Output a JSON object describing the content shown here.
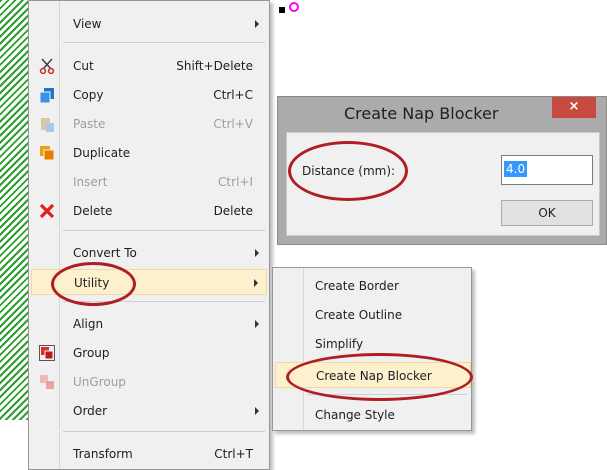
{
  "context_menu": {
    "items": [
      {
        "label": "View",
        "shortcut": "",
        "submenu": true,
        "disabled": false,
        "icon": ""
      },
      {
        "label": "Cut",
        "shortcut": "Shift+Delete",
        "submenu": false,
        "disabled": false,
        "icon": "scissors-icon"
      },
      {
        "label": "Copy",
        "shortcut": "Ctrl+C",
        "submenu": false,
        "disabled": false,
        "icon": "copy-icon"
      },
      {
        "label": "Paste",
        "shortcut": "Ctrl+V",
        "submenu": false,
        "disabled": true,
        "icon": "paste-icon"
      },
      {
        "label": "Duplicate",
        "shortcut": "",
        "submenu": false,
        "disabled": false,
        "icon": "duplicate-icon"
      },
      {
        "label": "Insert",
        "shortcut": "Ctrl+I",
        "submenu": false,
        "disabled": true,
        "icon": ""
      },
      {
        "label": "Delete",
        "shortcut": "Delete",
        "submenu": false,
        "disabled": false,
        "icon": "delete-x-icon"
      },
      {
        "label": "Convert To",
        "shortcut": "",
        "submenu": true,
        "disabled": false,
        "icon": ""
      },
      {
        "label": "Utility",
        "shortcut": "",
        "submenu": true,
        "disabled": false,
        "icon": "",
        "highlighted": true
      },
      {
        "label": "Align",
        "shortcut": "",
        "submenu": true,
        "disabled": false,
        "icon": ""
      },
      {
        "label": "Group",
        "shortcut": "",
        "submenu": false,
        "disabled": false,
        "icon": "group-icon"
      },
      {
        "label": "UnGroup",
        "shortcut": "",
        "submenu": false,
        "disabled": true,
        "icon": "ungroup-icon"
      },
      {
        "label": "Order",
        "shortcut": "",
        "submenu": true,
        "disabled": false,
        "icon": ""
      },
      {
        "label": "Transform",
        "shortcut": "Ctrl+T",
        "submenu": false,
        "disabled": false,
        "icon": ""
      }
    ]
  },
  "utility_submenu": {
    "items": [
      {
        "label": "Create Border"
      },
      {
        "label": "Create Outline"
      },
      {
        "label": "Simplify"
      },
      {
        "label": "Create Nap Blocker",
        "highlighted": true
      },
      {
        "label": "Change Style"
      }
    ]
  },
  "dialog": {
    "title": "Create Nap Blocker",
    "close_label": "×",
    "distance_label": "Distance (mm):",
    "distance_value": "4.0",
    "ok_label": "OK"
  },
  "colors": {
    "highlight": "#fcf0cd",
    "callout": "#b01e23",
    "selection": "#3399ff",
    "close_button": "#c74a40"
  }
}
